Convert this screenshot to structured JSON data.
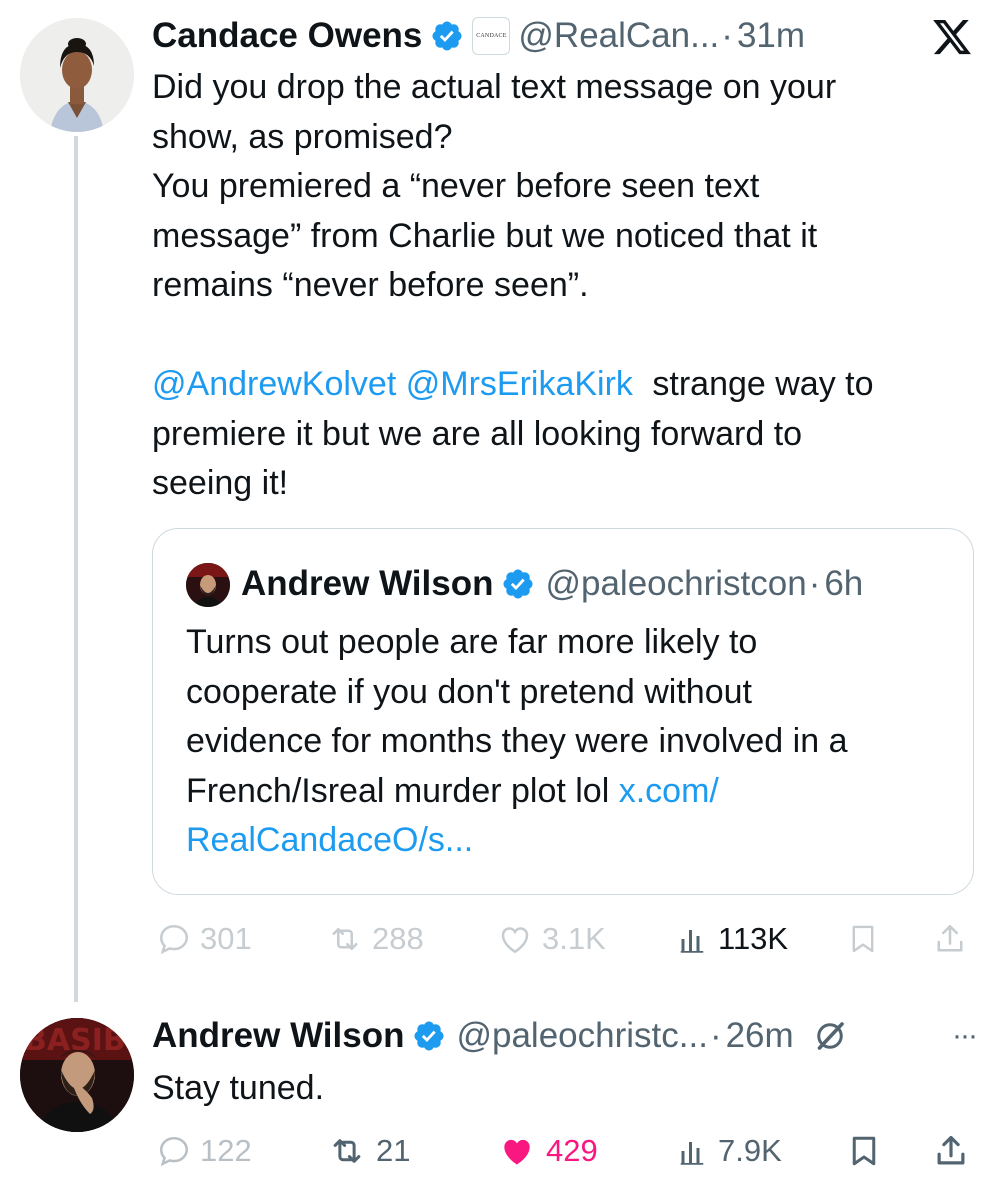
{
  "main_tweet": {
    "author_name": "Candace Owens",
    "affiliate_badge_text": "CANDACE",
    "handle": "@RealCan...",
    "separator": "·",
    "time": "31m",
    "text_lines": [
      "Did you drop the actual text message on your",
      "show, as promised?",
      "You premiered a “never before seen text",
      "message” from Charlie but we noticed that it",
      "remains “never before seen”."
    ],
    "mention_1": "@AndrewKolvet",
    "mention_2": "@MrsErikaKirk",
    "after_mentions": "strange way to",
    "text_lines_2": [
      "premiere it but we are all looking forward to",
      "seeing it!"
    ],
    "stats": {
      "replies": "301",
      "reposts": "288",
      "likes": "3.1K",
      "views": "113K"
    }
  },
  "quoted_tweet": {
    "author_name": "Andrew Wilson",
    "handle": "@paleochristcon",
    "separator": "·",
    "time": "6h",
    "text_lines": [
      "Turns out people are far more likely to",
      "cooperate if you don't pretend without",
      "evidence for months they were involved in a"
    ],
    "last_line_text": "French/Isreal murder plot lol",
    "link_part_1": "x.com/",
    "link_part_2": "RealCandaceO/s..."
  },
  "reply_tweet": {
    "author_name": "Andrew Wilson",
    "handle": "@paleochristc...",
    "separator": "·",
    "time": "26m",
    "more_label": "···",
    "text": "Stay tuned.",
    "stats": {
      "replies": "122",
      "reposts": "21",
      "likes": "429",
      "views": "7.9K"
    }
  },
  "colors": {
    "verified": "#1d9bf0",
    "link": "#1d9bf0",
    "like_active": "#f91880",
    "secondary_text": "#536471"
  },
  "icons": [
    "x-logo-icon",
    "verified-badge-icon",
    "reply-icon",
    "repost-icon",
    "like-icon",
    "views-icon",
    "bookmark-icon",
    "share-icon",
    "grok-icon",
    "more-icon"
  ]
}
